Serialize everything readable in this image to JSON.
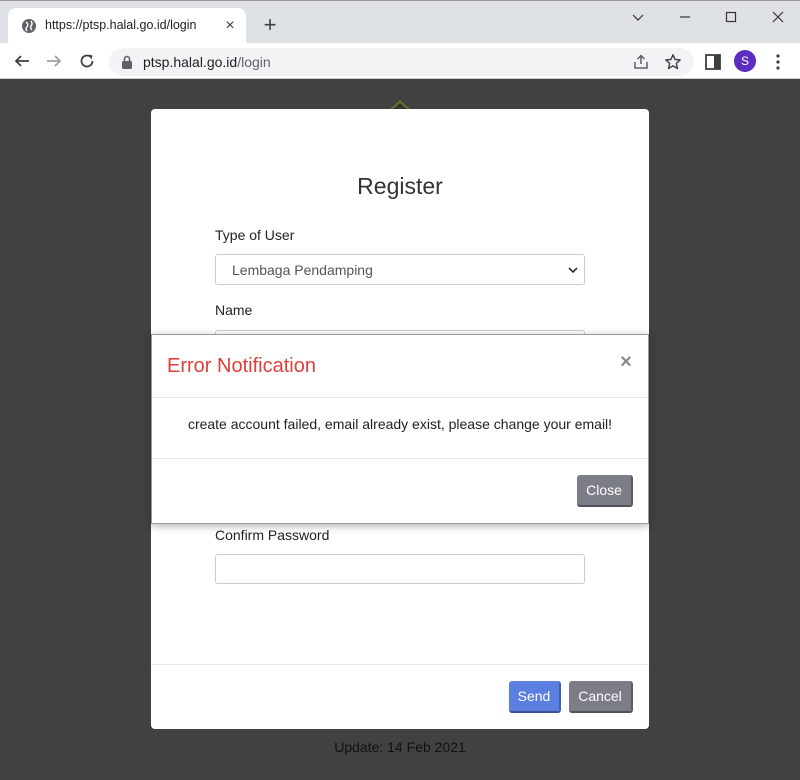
{
  "browser": {
    "tab_title": "https://ptsp.halal.go.id/login",
    "tab_close_glyph": "×",
    "new_tab_glyph": "+",
    "url_host": "ptsp.halal.go.id",
    "url_path": "/login",
    "profile_initial": "S",
    "profile_color": "#5b2cc0"
  },
  "register": {
    "title": "Register",
    "type_of_user_label": "Type of User",
    "type_of_user_value": "Lembaga Pendamping",
    "name_label": "Name",
    "confirm_password_label": "Confirm Password",
    "send_label": "Send",
    "cancel_label": "Cancel",
    "send_color": "#5b7fe0"
  },
  "error_modal": {
    "title": "Error Notification",
    "title_color": "#e0403a",
    "close_glyph": "×",
    "message": "create account failed, email already exist, please change your email!",
    "close_label": "Close"
  },
  "footer": {
    "update_text": "Update: 14 Feb 2021"
  },
  "icons": [
    "globe-icon",
    "close-icon",
    "plus-icon",
    "chevron-down-icon",
    "minimize-icon",
    "maximize-icon",
    "window-close-icon",
    "back-arrow-icon",
    "forward-arrow-icon",
    "reload-icon",
    "lock-icon",
    "share-icon",
    "star-icon",
    "side-panel-icon",
    "more-vert-icon"
  ]
}
